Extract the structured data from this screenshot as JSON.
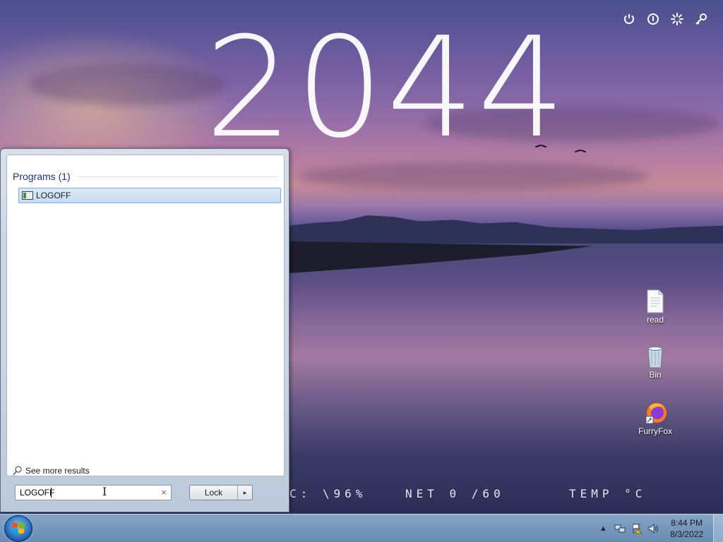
{
  "desktop": {
    "year": "2044",
    "stats": {
      "cpu": "C: \\96%",
      "net": "NET 0 /60",
      "temp": "TEMP °C"
    },
    "icons": [
      {
        "label": "read",
        "icon": "text-file-icon"
      },
      {
        "label": "Bin",
        "icon": "recycle-bin-icon"
      },
      {
        "label": "FurryFox",
        "icon": "firefox-shortcut-icon"
      }
    ]
  },
  "power_icons": [
    "power-icon",
    "info-icon",
    "loading-icon",
    "key-icon"
  ],
  "start_menu": {
    "programs_header": "Programs (1)",
    "results": [
      {
        "label": "LOGOFF",
        "icon": "program-icon"
      }
    ],
    "see_more": "See more results",
    "search": {
      "value": "LOGOFF",
      "clear": "×"
    },
    "lock_button": {
      "label": "Lock",
      "arrow": "▸"
    }
  },
  "taskbar": {
    "clock": {
      "time": "8:44 PM",
      "date": "8/3/2022"
    },
    "tray_icons": [
      "show-hidden-icons",
      "network-icon",
      "action-center-icon",
      "volume-icon"
    ]
  },
  "colors": {
    "accent": "#1e3287",
    "selection": "#c6dcf3",
    "taskbar": "#8fb4d6"
  }
}
